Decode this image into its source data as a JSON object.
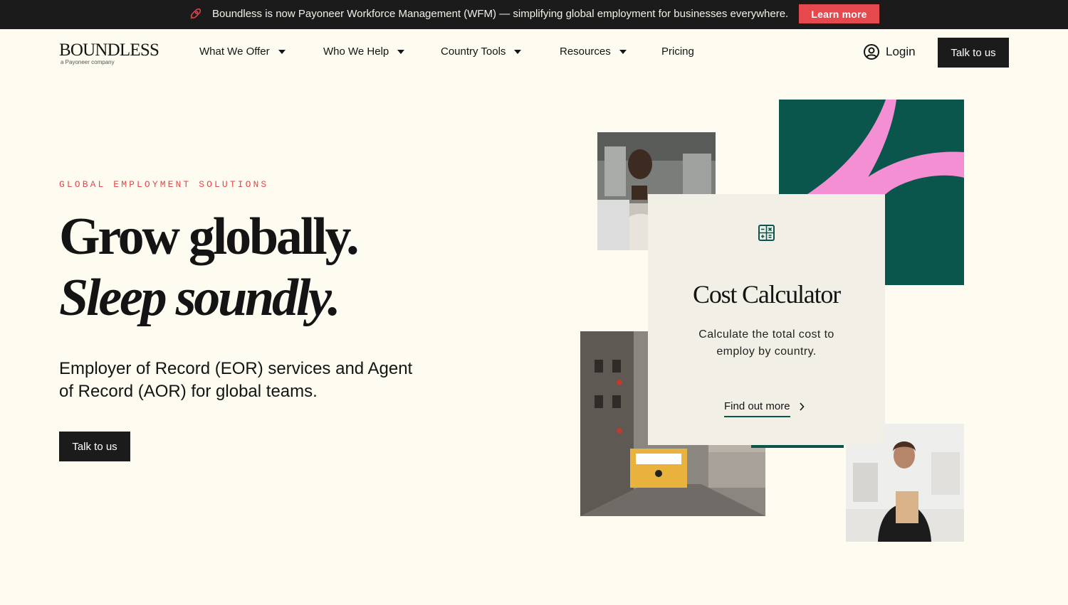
{
  "announcement": {
    "icon": "rocket-icon",
    "text": "Boundless is now Payoneer Workforce Management (WFM) — simplifying global employment for businesses everywhere.",
    "button": "Learn more"
  },
  "logo": {
    "name": "BOUNDLESS",
    "tagline": "a Payoneer company"
  },
  "nav": {
    "items": [
      {
        "label": "What We Offer"
      },
      {
        "label": "Who We Help"
      },
      {
        "label": "Country Tools"
      },
      {
        "label": "Resources"
      },
      {
        "label": "Pricing"
      }
    ],
    "login": "Login",
    "cta": "Talk to us"
  },
  "hero": {
    "eyebrow": "GLOBAL EMPLOYMENT SOLUTIONS",
    "title_line1": "Grow globally.",
    "title_line2": "Sleep soundly.",
    "subtitle": "Employer of Record (EOR) services and Agent of Record (AOR) for global teams.",
    "cta": "Talk to us"
  },
  "card": {
    "icon": "calculator-icon",
    "title": "Cost Calculator",
    "description": "Calculate the total cost to employ by country.",
    "link": "Find out more"
  },
  "colors": {
    "accent_red": "#e5484d",
    "dark_green": "#0a564c",
    "pink": "#f48fd3",
    "background": "#fefcf0",
    "dark": "#1b1b1b"
  }
}
